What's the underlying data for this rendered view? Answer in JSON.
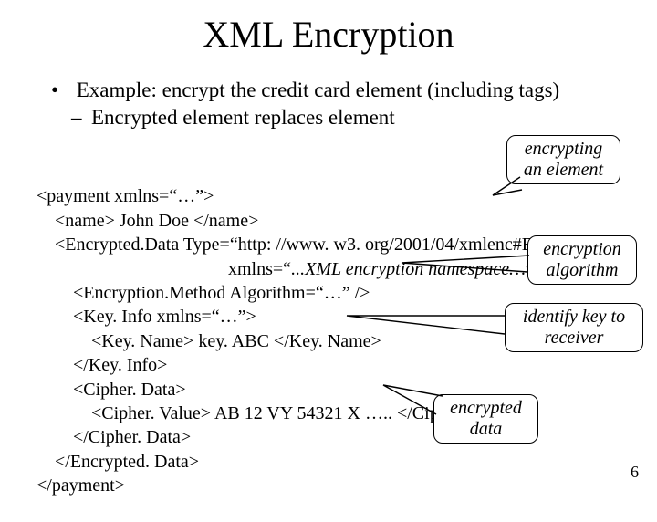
{
  "title": "XML Encryption",
  "bullet_main": "Example: encrypt the credit card element (including tags)",
  "bullet_sub": "Encrypted element replaces element",
  "code": {
    "l1": "<payment xmlns=“…”>",
    "l2": "    <name> John Doe </name>",
    "l3": "    <Encrypted.Data Type=“http: //www. w3. org/2001/04/xmlenc#Element",
    "l4_a": "                                          xmlns=“",
    "l4_b": "...XML encryption namespace…",
    "l4_c": "”>",
    "l5": "        <Encryption.Method Algorithm=“…” />",
    "l6": "        <Key. Info xmlns=“…”>",
    "l7": "            <Key. Name> key. ABC </Key. Name>",
    "l8": "        </Key. Info>",
    "l9": "        <Cipher. Data>",
    "l10": "            <Cipher. Value> AB 12 VY 54321 X ….. </Cipher. Value>",
    "l11": "        </Cipher. Data>",
    "l12": "    </Encrypted. Data>",
    "l13": "</payment>"
  },
  "callouts": {
    "c1": "encrypting an element",
    "c2": "encryption algorithm",
    "c3": "identify key to receiver",
    "c4": "encrypted data"
  },
  "page_number": "6"
}
